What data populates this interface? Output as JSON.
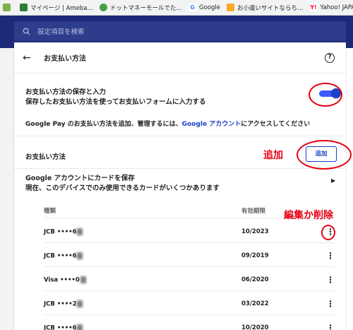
{
  "bookmarks": [
    {
      "label": "",
      "icon": "apps-grid-icon",
      "color": "#7cb342"
    },
    {
      "label": "マイページ | Ameba…",
      "icon": "ameba-icon",
      "color": "#2e7d32"
    },
    {
      "label": "ドットマネーモールでた…",
      "icon": "dotmoney-icon",
      "color": "#43a047"
    },
    {
      "label": "Google",
      "icon": "google-icon",
      "color": "#4285f4"
    },
    {
      "label": "お小遣いサイトならち…",
      "icon": "okozukai-icon",
      "color": "#f9a825"
    },
    {
      "label": "Yahoo! JAPAN",
      "icon": "yahoo-icon",
      "color": "#ff0033"
    }
  ],
  "search": {
    "placeholder": "設定項目を検索"
  },
  "page": {
    "title": "お支払い方法"
  },
  "save_section": {
    "title": "お支払い方法の保存と入力",
    "subtitle": "保存したお支払い方法を使ってお支払いフォームに入力する",
    "enabled": true
  },
  "gpay": {
    "before": "Google Pay のお支払い方法を追加、管理するには、",
    "link": "Google アカウント",
    "after": "にアクセスしてください"
  },
  "methods": {
    "label": "お支払い方法",
    "add_label": "追加"
  },
  "google_card": {
    "title": "Google アカウントにカードを保存",
    "subtitle": "現在、このデバイスでのみ使用できるカードがいくつかあります"
  },
  "table": {
    "headers": {
      "type": "種類",
      "expiry": "有効期限"
    },
    "rows": [
      {
        "type": "JCB ••••6",
        "expiry": "10/2023"
      },
      {
        "type": "JCB ••••6",
        "expiry": "09/2019"
      },
      {
        "type": "Visa ••••0",
        "expiry": "06/2020"
      },
      {
        "type": "JCB ••••2",
        "expiry": "03/2022"
      },
      {
        "type": "JCB ••••6",
        "expiry": "10/2020"
      }
    ]
  },
  "annotations": {
    "add": "追加",
    "edit_delete": "編集か削除",
    "color": "#e60012"
  }
}
